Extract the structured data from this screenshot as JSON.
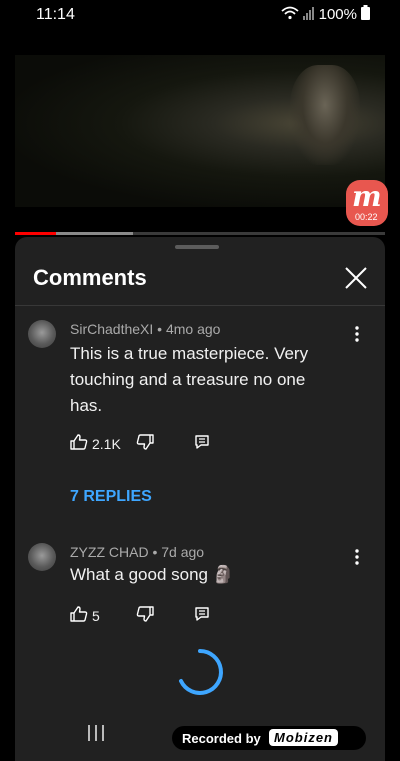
{
  "status_bar": {
    "time": "11:14",
    "battery": "100%"
  },
  "video": {
    "progress": 0.11,
    "buffered": 0.32
  },
  "overlay": {
    "mobizen_letter": "m",
    "mobizen_timer": "00:22",
    "recorded_by": "Recorded by",
    "brand": "Mobizen"
  },
  "comments_panel": {
    "title": "Comments",
    "comments": [
      {
        "author_meta": "SirChadtheXI • 4mo ago",
        "text": "This is a true masterpiece. Very touching and a treasure no one has.",
        "likes": "2.1K",
        "replies_label": "7 REPLIES"
      },
      {
        "author_meta": "ZYZZ CHAD • 7d ago",
        "text": "What a good song 🗿",
        "likes": "5"
      }
    ]
  },
  "colors": {
    "panel_bg": "#212121",
    "link": "#3ea6ff",
    "progress": "#ff0000",
    "spinner": "#3ea6ff"
  },
  "icons": [
    "wifi-icon",
    "signal-icon",
    "battery-icon",
    "close-icon",
    "more-vert-icon",
    "thumb-up-icon",
    "thumb-down-icon",
    "reply-icon",
    "loading-spinner",
    "recent-apps-icon"
  ]
}
